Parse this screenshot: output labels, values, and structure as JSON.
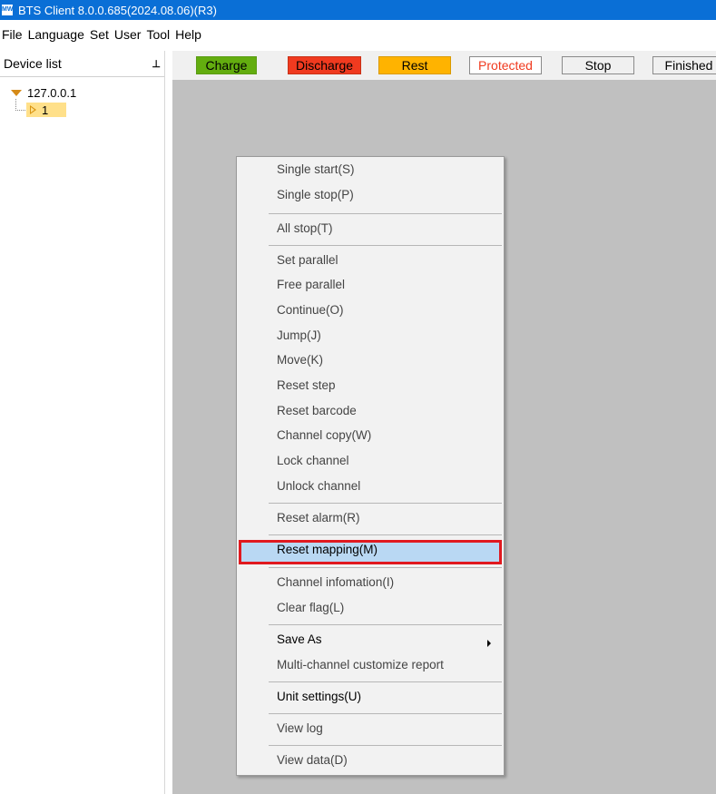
{
  "window": {
    "title": "BTS Client 8.0.0.685(2024.08.06)(R3)",
    "icon_name": "app-icon"
  },
  "menubar": {
    "items": [
      "File",
      "Language",
      "Set",
      "User",
      "Tool",
      "Help"
    ]
  },
  "sidebar": {
    "header": "Device list",
    "pin_icon": "pin-icon",
    "tree": {
      "node_label": "127.0.0.1",
      "channel_label": "1"
    }
  },
  "status_buttons": [
    {
      "label": "Charge",
      "bg": "#63ad0f",
      "color": "#000000",
      "border": "#5a9b15"
    },
    {
      "label": "Discharge",
      "bg": "#f03a1f",
      "color": "#000000",
      "border": "#c83117"
    },
    {
      "label": "Rest",
      "bg": "#ffb300",
      "color": "#000000",
      "border": "#d99a00"
    },
    {
      "label": "Protected",
      "bg": "#ffffff",
      "color": "#f03a1f",
      "border": "#8a8a8a"
    },
    {
      "label": "Stop",
      "bg": "#f0f0f0",
      "color": "#000000",
      "border": "#8a8a8a"
    },
    {
      "label": "Finished",
      "bg": "#f0f0f0",
      "color": "#000000",
      "border": "#8a8a8a"
    }
  ],
  "context_menu": {
    "items": [
      {
        "label": "Single start(S)"
      },
      {
        "label": "Single stop(P)"
      },
      {
        "label": "All stop(T)"
      },
      {
        "label": "Set parallel"
      },
      {
        "label": "Free parallel"
      },
      {
        "label": "Continue(O)"
      },
      {
        "label": "Jump(J)"
      },
      {
        "label": "Move(K)"
      },
      {
        "label": "Reset step"
      },
      {
        "label": "Reset barcode"
      },
      {
        "label": "Channel copy(W)"
      },
      {
        "label": "Lock channel"
      },
      {
        "label": "Unlock channel"
      },
      {
        "label": "Reset alarm(R)"
      },
      {
        "label": "Reset mapping(M)"
      },
      {
        "label": "Channel infomation(I)"
      },
      {
        "label": "Clear flag(L)"
      },
      {
        "label": "Save As"
      },
      {
        "label": "Multi-channel customize report"
      },
      {
        "label": "Unit settings(U)"
      },
      {
        "label": "View log"
      },
      {
        "label": "View data(D)"
      }
    ],
    "highlight_color": "#b9d8f3",
    "highlight_border": "#e0191f"
  }
}
